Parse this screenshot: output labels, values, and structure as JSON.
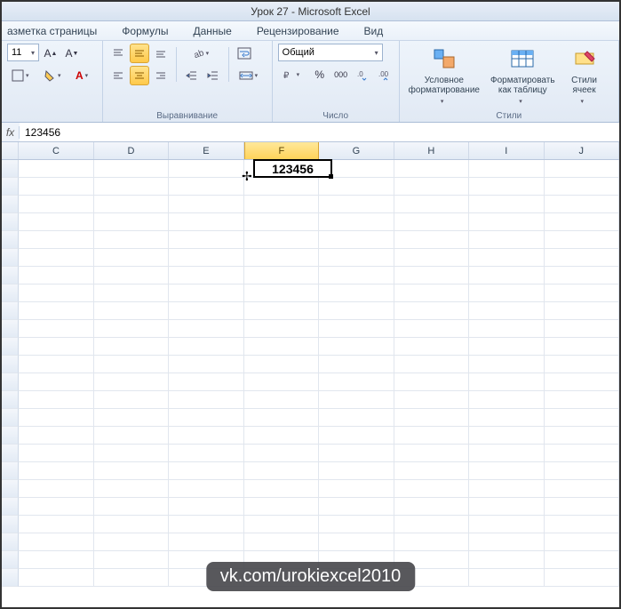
{
  "title": "Урок 27  -  Microsoft Excel",
  "tabs": {
    "page_layout": "азметка страницы",
    "formulas": "Формулы",
    "data": "Данные",
    "review": "Рецензирование",
    "view": "Вид"
  },
  "font": {
    "size": "11"
  },
  "alignment": {
    "group_label": "Выравнивание"
  },
  "number": {
    "group_label": "Число",
    "format": "Общий",
    "percent": "%",
    "thousands": "000"
  },
  "styles": {
    "group_label": "Стили",
    "conditional": "Условное\nформатирование",
    "table": "Форматировать\nкак таблицу",
    "cell": "Стили\nячеек"
  },
  "formula_bar": {
    "value": "123456"
  },
  "columns": [
    "C",
    "D",
    "E",
    "F",
    "G",
    "H",
    "I",
    "J"
  ],
  "active_cell": {
    "col": "F",
    "row": 1,
    "value": "123456"
  },
  "watermark": "vk.com/urokiexcel2010"
}
